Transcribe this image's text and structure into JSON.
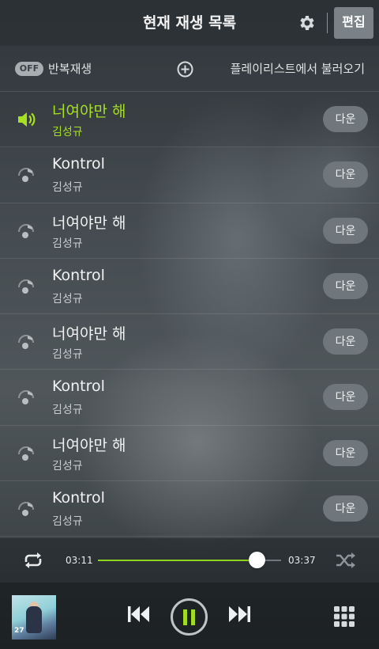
{
  "header": {
    "title": "현재 재생 목록",
    "edit_label": "편집"
  },
  "options": {
    "repeat_badge": "OFF",
    "repeat_label": "반복재생",
    "load_playlist_label": "플레이리스트에서 불러오기"
  },
  "tracks": [
    {
      "title": "너여야만 해",
      "artist": "김성규",
      "down": "다운",
      "active": true
    },
    {
      "title": "Kontrol",
      "artist": "김성규",
      "down": "다운",
      "active": false
    },
    {
      "title": "너여야만 해",
      "artist": "김성규",
      "down": "다운",
      "active": false
    },
    {
      "title": "Kontrol",
      "artist": "김성규",
      "down": "다운",
      "active": false
    },
    {
      "title": "너여야만 해",
      "artist": "김성규",
      "down": "다운",
      "active": false
    },
    {
      "title": "Kontrol",
      "artist": "김성규",
      "down": "다운",
      "active": false
    },
    {
      "title": "너여야만 해",
      "artist": "김성규",
      "down": "다운",
      "active": false
    },
    {
      "title": "Kontrol",
      "artist": "김성규",
      "down": "다운",
      "active": false
    }
  ],
  "player": {
    "current_time": "03:11",
    "total_time": "03:37",
    "progress": 0.866,
    "accent": "#a6e022",
    "album_text": "27"
  },
  "icons": {
    "settings": "gear-icon",
    "add": "plus-circle-icon",
    "now_playing": "speaker-icon",
    "track": "music-note-icon",
    "repeat": "repeat-icon",
    "shuffle": "shuffle-icon",
    "prev": "skip-previous-icon",
    "pause": "pause-icon",
    "next": "skip-next-icon",
    "menu": "grid-icon"
  }
}
